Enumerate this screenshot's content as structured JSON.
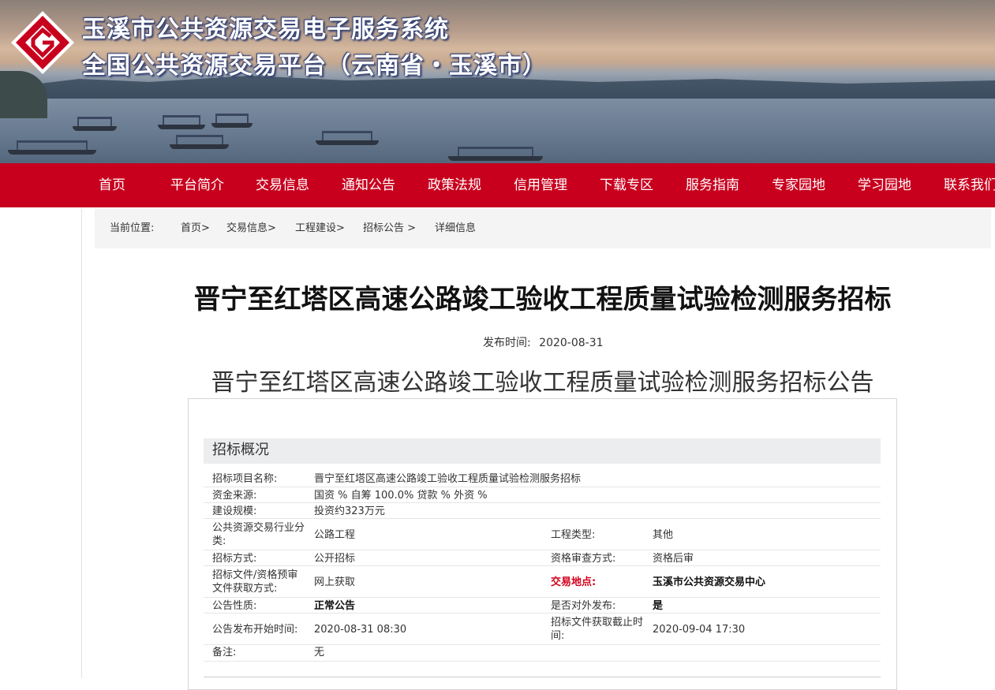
{
  "header": {
    "title_line1": "玉溪市公共资源交易电子服务系统",
    "title_line2": "全国公共资源交易平台（云南省・玉溪市）"
  },
  "nav": [
    "首页",
    "平台简介",
    "交易信息",
    "通知公告",
    "政策法规",
    "信用管理",
    "下载专区",
    "服务指南",
    "专家园地",
    "学习园地",
    "联系我们"
  ],
  "breadcrumb": {
    "label": "当前位置:",
    "items": [
      "首页>",
      "交易信息>",
      "工程建设>",
      "招标公告 >",
      "详细信息"
    ]
  },
  "article": {
    "title": "晋宁至红塔区高速公路竣工验收工程质量试验检测服务招标",
    "publish_label": "发布时间:",
    "publish_date": "2020-08-31",
    "subtitle": "晋宁至红塔区高速公路竣工验收工程质量试验检测服务招标公告"
  },
  "overview": {
    "heading": "招标概况",
    "project_name_label": "招标项目名称:",
    "project_name": "晋宁至红塔区高速公路竣工验收工程质量试验检测服务招标",
    "funding_label": "资金来源:",
    "funding": "国资 % 自筹 100.0% 贷款 % 外资 %",
    "scale_label": "建设规模:",
    "scale": "投资约323万元",
    "industry_label_1": "公共资源交易行业分",
    "industry_label_2": "类:",
    "industry": "公路工程",
    "project_type_label": "工程类型:",
    "project_type": "其他",
    "method_label": "招标方式:",
    "method": "公开招标",
    "review_label": "资格审查方式:",
    "review": "资格后审",
    "doc_label_1": "招标文件/资格预审",
    "doc_label_2": "文件获取方式:",
    "doc": "网上获取",
    "location_label": "交易地点:",
    "location": "玉溪市公共资源交易中心",
    "nature_label": "公告性质:",
    "nature": "正常公告",
    "external_label": "是否对外发布:",
    "external": "是",
    "start_label": "公告发布开始时间:",
    "start": "2020-08-31 08:30",
    "deadline_label_1": "招标文件获取截止时",
    "deadline_label_2": "间:",
    "deadline": "2020-09-04 17:30",
    "remark_label": "备注:",
    "remark": "无"
  },
  "colors": {
    "nav_bg": "#c8001e",
    "accent_red": "#d4001c"
  }
}
